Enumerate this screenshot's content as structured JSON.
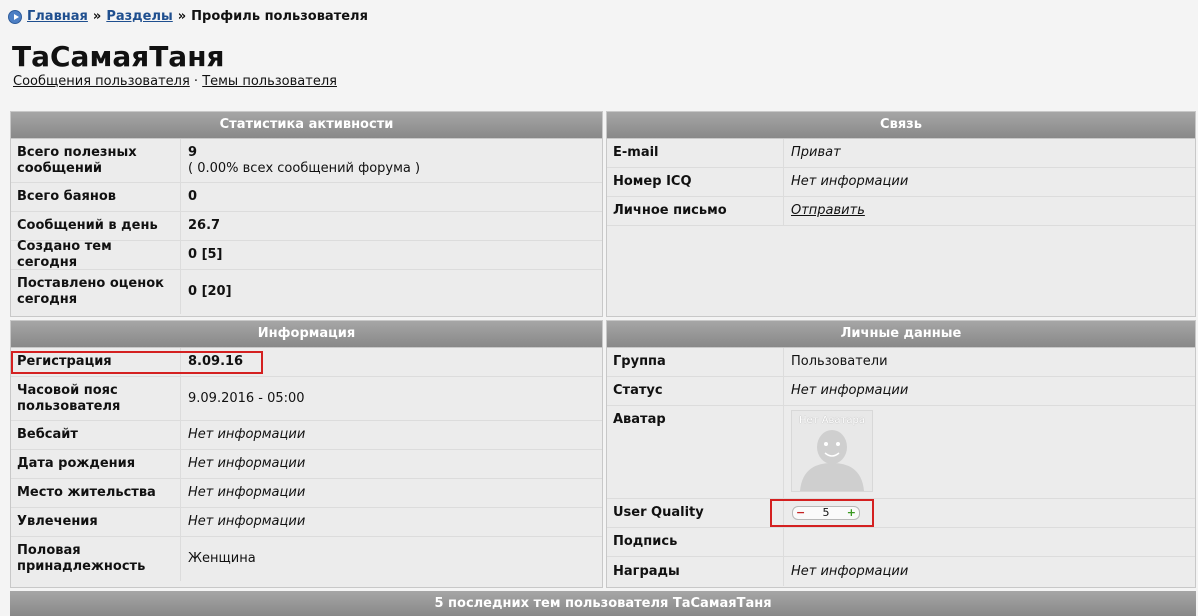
{
  "breadcrumb": {
    "home": "Главная",
    "sections": "Разделы",
    "separator": "»",
    "current": "Профиль пользователя"
  },
  "profile": {
    "username": "ТаСамаяТаня",
    "links": {
      "posts": "Сообщения пользователя",
      "dot": "·",
      "topics": "Темы пользователя"
    }
  },
  "stats": {
    "title": "Статистика активности",
    "rows": [
      {
        "label": "Всего полезных сообщений",
        "value": "9",
        "note": "( 0.00% всех сообщений форума )"
      },
      {
        "label": "Всего баянов",
        "value": "0"
      },
      {
        "label": "Сообщений в день",
        "value": "26.7"
      },
      {
        "label": "Создано тем сегодня",
        "value": "0 [5]"
      },
      {
        "label": "Поставлено оценок сегодня",
        "value": "0 [20]"
      }
    ]
  },
  "contact": {
    "title": "Связь",
    "rows": [
      {
        "label": "E-mail",
        "value": "Приват"
      },
      {
        "label": "Номер ICQ",
        "value": "Нет информации"
      },
      {
        "label": "Личное письмо",
        "value": "Отправить"
      }
    ]
  },
  "info": {
    "title": "Информация",
    "rows": [
      {
        "label": "Регистрация",
        "value": "8.09.16"
      },
      {
        "label": "Часовой пояс пользователя",
        "value": "9.09.2016 - 05:00"
      },
      {
        "label": "Вебсайт",
        "value": "Нет информации"
      },
      {
        "label": "Дата рождения",
        "value": "Нет информации"
      },
      {
        "label": "Место жительства",
        "value": "Нет информации"
      },
      {
        "label": "Увлечения",
        "value": "Нет информации"
      },
      {
        "label": "Половая принадлежность",
        "value": "Женщина"
      }
    ]
  },
  "personal": {
    "title": "Личные данные",
    "rows": [
      {
        "label": "Группа",
        "value": "Пользователи"
      },
      {
        "label": "Статус",
        "value": "Нет информации"
      },
      {
        "label": "Аватар",
        "value": "Нет Аватара"
      },
      {
        "label": "User Quality",
        "minus": "−",
        "value": "5",
        "plus": "+"
      },
      {
        "label": "Подпись",
        "value": ""
      },
      {
        "label": "Награды",
        "value": "Нет информации"
      }
    ]
  },
  "recent": {
    "title": "5 последних тем пользователя ТаСамаяТаня"
  },
  "colors": {
    "header_bg": "#999999",
    "highlight": "#d42020",
    "link": "#1f4f8f"
  }
}
